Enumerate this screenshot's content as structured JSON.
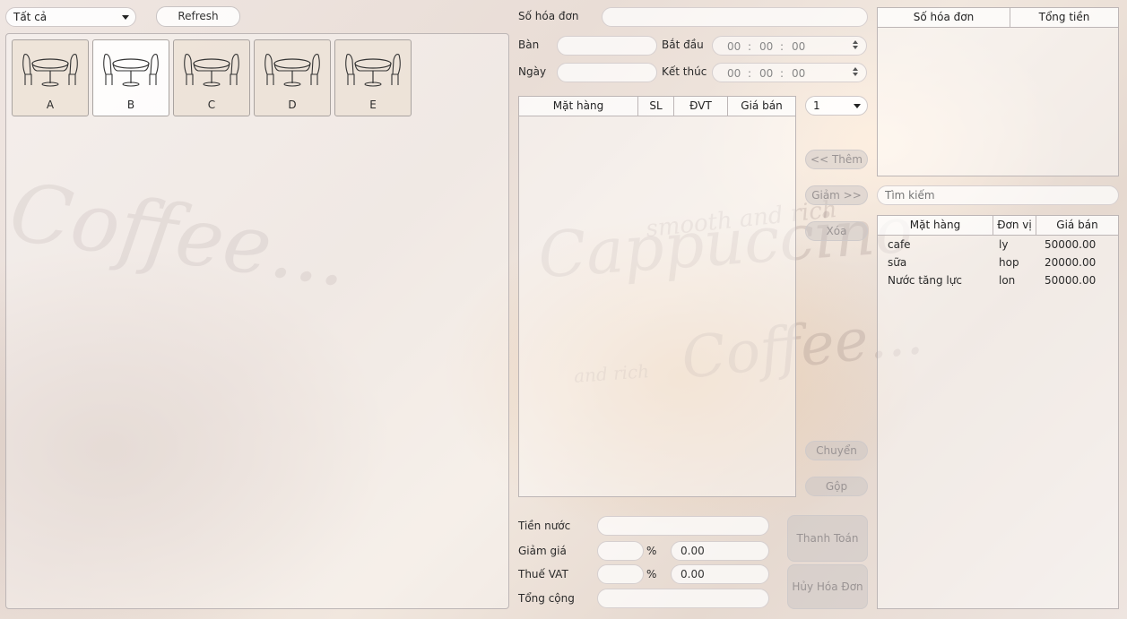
{
  "left": {
    "filter_value": "Tất cả",
    "refresh_label": "Refresh",
    "tables": [
      {
        "name": "A",
        "status": "occupied"
      },
      {
        "name": "B",
        "status": "free"
      },
      {
        "name": "C",
        "status": "occupied"
      },
      {
        "name": "D",
        "status": "occupied"
      },
      {
        "name": "E",
        "status": "occupied"
      }
    ]
  },
  "invoice": {
    "so_hoa_don_label": "Số hóa đơn",
    "so_hoa_don_value": "",
    "ban_label": "Bàn",
    "ban_value": "",
    "ngay_label": "Ngày",
    "ngay_value": "",
    "bat_dau_label": "Bắt đầu",
    "ket_thuc_label": "Kết thúc",
    "time_hh": "00",
    "time_mm": "00",
    "time_ss": "00",
    "time_sep": ":"
  },
  "order_table": {
    "headers": [
      "Mặt hàng",
      "SL",
      "ĐVT",
      "Giá bán"
    ],
    "rows": []
  },
  "qty_select": "1",
  "actions": {
    "them": "<< Thêm",
    "giam": "Giảm >>",
    "xoa": "Xóa",
    "chuyen": "Chuyển",
    "gop": "Gộp",
    "thanh_toan": "Thanh Toán",
    "huy_hoa_don": "Hủy Hóa Đơn"
  },
  "totals": {
    "tien_nuoc_label": "Tiền nước",
    "tien_nuoc_value": "",
    "giam_gia_label": "Giảm giá",
    "giam_gia_percent": "",
    "giam_gia_amount": "0.00",
    "vat_label": "Thuế VAT",
    "vat_percent": "",
    "vat_amount": "0.00",
    "percent_symbol": "%",
    "tong_cong_label": "Tổng cộng",
    "tong_cong_value": ""
  },
  "invoice_list": {
    "headers": [
      "Số hóa đơn",
      "Tổng tiền"
    ],
    "rows": []
  },
  "search": {
    "placeholder": "Tìm kiếm"
  },
  "menu_table": {
    "headers": [
      "Mặt hàng",
      "Đơn vị",
      "Giá bán"
    ],
    "rows": [
      {
        "name": "cafe",
        "unit": "ly",
        "price": "50000.00"
      },
      {
        "name": "sữa",
        "unit": "hop",
        "price": "20000.00"
      },
      {
        "name": "Nước tăng lực",
        "unit": "lon",
        "price": "50000.00"
      }
    ]
  },
  "colors": {
    "panel_border": "#bdb6b6",
    "button_disabled": "#c8c4c4",
    "occupied_tile": "#ece2d6",
    "free_tile": "#ffffff"
  }
}
